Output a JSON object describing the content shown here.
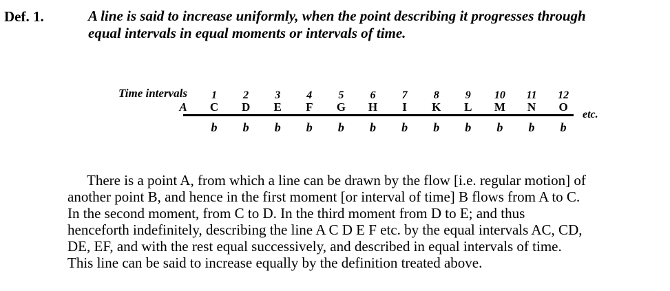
{
  "definition": {
    "label": "Def. 1.",
    "line1": "A line is said to increase uniformly, when the point describing it progresses through",
    "line2": "equal intervals in equal moments or intervals of time."
  },
  "diagram": {
    "time_label": "Time intervals",
    "start_point": "A",
    "intervals": [
      {
        "number": "1",
        "letter": "C"
      },
      {
        "number": "2",
        "letter": "D"
      },
      {
        "number": "3",
        "letter": "E"
      },
      {
        "number": "4",
        "letter": "F"
      },
      {
        "number": "5",
        "letter": "G"
      },
      {
        "number": "6",
        "letter": "H"
      },
      {
        "number": "7",
        "letter": "I"
      },
      {
        "number": "8",
        "letter": "K"
      },
      {
        "number": "9",
        "letter": "L"
      },
      {
        "number": "10",
        "letter": "M"
      },
      {
        "number": "11",
        "letter": "N"
      },
      {
        "number": "12",
        "letter": "O"
      }
    ],
    "etc_label": "etc.",
    "b_symbol": "b"
  },
  "body": {
    "lines": [
      "There is a point A, from which a line can be drawn by the flow [i.e. regular motion] of",
      "another point B, and hence in the first moment [or interval of time] B flows from A to C.",
      "In the second moment, from C to D. In the third moment from D to E; and thus",
      "henceforth indefinitely, describing the line A C D E F etc. by the equal intervals AC, CD,",
      "DE, EF, and with the rest equal successively, and described in equal intervals of time.",
      "This line can be said to increase equally by the definition treated above."
    ]
  }
}
